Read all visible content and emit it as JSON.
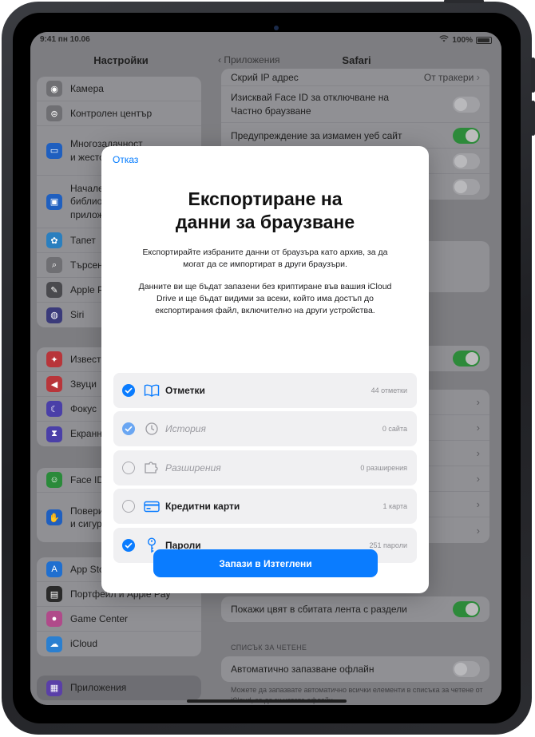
{
  "status": {
    "time": "9:41",
    "date": "пн 10.06",
    "battery": "100%"
  },
  "sidebar": {
    "title": "Настройки",
    "group1": [
      {
        "label": "Камера",
        "icon": "camera-icon",
        "color": "#6f6f73"
      },
      {
        "label": "Контролен център",
        "icon": "control-center-icon",
        "color": "#6f6f73"
      },
      {
        "label": "Многозадачност\nи жестове",
        "icon": "multitasking-icon",
        "color": "#1f5fbf"
      },
      {
        "label": "Начален\nбиблиотека\nприложения",
        "icon": "home-screen-icon",
        "color": "#1f5fbf"
      },
      {
        "label": "Тапет",
        "icon": "wallpaper-icon",
        "color": "#2a7fbf"
      },
      {
        "label": "Търсене",
        "icon": "search-icon",
        "color": "#6f6f73"
      },
      {
        "label": "Apple Pencil",
        "icon": "pencil-icon",
        "color": "#4a4a4e"
      },
      {
        "label": "Siri",
        "icon": "siri-icon",
        "color": "#3a3a7a"
      }
    ],
    "group2": [
      {
        "label": "Известия",
        "icon": "bell-icon",
        "color": "#b8353a"
      },
      {
        "label": "Звуци",
        "icon": "speaker-icon",
        "color": "#b8353a"
      },
      {
        "label": "Фокус",
        "icon": "moon-icon",
        "color": "#4a3fa8"
      },
      {
        "label": "Екранно време",
        "icon": "hourglass-icon",
        "color": "#4a3fa8"
      }
    ],
    "group3": [
      {
        "label": "Face ID",
        "icon": "face-id-icon",
        "color": "#2a8a3a"
      },
      {
        "label": "Поверителност\nи сигурност",
        "icon": "hand-icon",
        "color": "#1f5fbf"
      }
    ],
    "group4": [
      {
        "label": "App Store",
        "icon": "app-store-icon",
        "color": "#1f6fd0"
      },
      {
        "label": "Портфейл и Apple Pay",
        "icon": "wallet-icon",
        "color": "#2a2a2a"
      },
      {
        "label": "Game Center",
        "icon": "game-center-icon",
        "color": "#b04a8a"
      },
      {
        "label": "iCloud",
        "icon": "icloud-icon",
        "color": "#2a7fd0"
      }
    ],
    "apps": {
      "label": "Приложения",
      "icon": "apps-icon",
      "color": "#5a3fa8"
    }
  },
  "detail": {
    "back_label": "Приложения",
    "title": "Safari",
    "row_hide_ip": {
      "label": "Скрий IP адрес",
      "value": "От тракери"
    },
    "row_faceid": "Изисквай Face ID за отключване на Частно браузване",
    "row_warning": "Предупреждение за измамен уеб сайт",
    "row_tab_color": "Покажи цвят в сбитата лента с раздели",
    "reading_list_header": "СПИСЪК ЗА ЧЕТЕНЕ",
    "row_auto_save": "Автоматично запазване офлайн",
    "reading_list_note": "Можете да запазвате автоматично всички елементи в списъка за четене от iCloud, за да ги четете офлайн."
  },
  "modal": {
    "cancel": "Отказ",
    "title": "Експортиране на\nданни за браузване",
    "desc1": "Експортирайте избраните данни от браузъра като архив, за да могат да се импортират в други браузъри.",
    "desc2": "Данните ви ще бъдат запазени без криптиране във вашия iCloud Drive и ще бъдат видими за всеки, който има достъп до експортирания файл, включително на други устройства.",
    "options": [
      {
        "label": "Отметки",
        "count": "44 отметки",
        "checked": true,
        "dim": false,
        "icon": "book-icon"
      },
      {
        "label": "История",
        "count": "0 сайта",
        "checked": true,
        "dim": true,
        "icon": "clock-icon"
      },
      {
        "label": "Разширения",
        "count": "0 разширения",
        "checked": false,
        "dim": true,
        "icon": "puzzle-icon"
      },
      {
        "label": "Кредитни карти",
        "count": "1 карта",
        "checked": false,
        "dim": false,
        "icon": "credit-card-icon"
      },
      {
        "label": "Пароли",
        "count": "251 пароли",
        "checked": true,
        "dim": false,
        "icon": "key-icon"
      }
    ],
    "save_button": "Запази в Изтеглени"
  },
  "colors": {
    "accent": "#0a7cff",
    "toggle_on": "#34c759"
  }
}
